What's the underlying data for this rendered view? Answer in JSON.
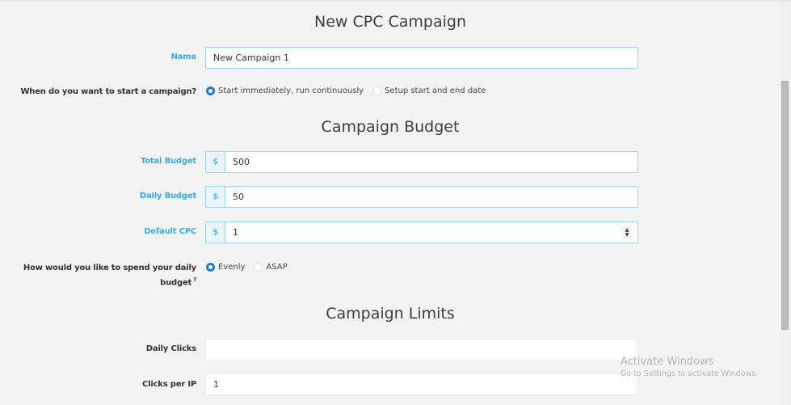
{
  "page": {
    "title": "New CPC Campaign"
  },
  "name_field": {
    "label": "Name",
    "value": "New Campaign 1"
  },
  "start": {
    "question": "When do you want to start a campaign?",
    "options": [
      {
        "label": "Start immediately, run continuously",
        "selected": true
      },
      {
        "label": "Setup start and end date",
        "selected": false
      }
    ]
  },
  "budget": {
    "title": "Campaign Budget",
    "currency_symbol": "$",
    "total": {
      "label": "Total Budget",
      "value": "500"
    },
    "daily": {
      "label": "Daily Budget",
      "value": "50"
    },
    "default_cpc": {
      "label": "Default CPC",
      "value": "1"
    },
    "spend": {
      "question_line1": "How would you like to spend your daily",
      "question_line2": "budget",
      "help_mark": "?",
      "options": [
        {
          "label": "Evenly",
          "selected": true
        },
        {
          "label": "ASAP",
          "selected": false
        }
      ]
    }
  },
  "limits": {
    "title": "Campaign Limits",
    "daily_clicks": {
      "label": "Daily Clicks",
      "value": ""
    },
    "clicks_per_ip": {
      "label": "Clicks per IP",
      "value": "1"
    }
  },
  "watermark": {
    "line1": "Activate Windows",
    "line2": "Go to Settings to activate Windows."
  },
  "colors": {
    "accent": "#3fa9df",
    "radio_selected": "#1a7fd0"
  }
}
